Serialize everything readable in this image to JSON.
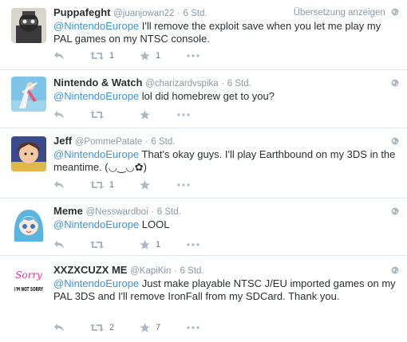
{
  "colors": {
    "link": "#3b94d9",
    "meta": "#8899a6",
    "icon": "#aab8c2",
    "divider": "#e1e8ed"
  },
  "tweets": [
    {
      "name": "Puppafeght",
      "handle": "@juanjowan22",
      "sep": "·",
      "time": "6 Std.",
      "translate_label": "Übersetzung anzeigen",
      "mention": "@NintendoEurope",
      "text": " I'll remove the exploit save when you let me play my PAL games on my NTSC console.",
      "retweets": "1",
      "favorites": "1"
    },
    {
      "name": "Nintendo & Watch",
      "handle": "@charizardvspika",
      "sep": "·",
      "time": "6 Std.",
      "mention": "@NintendoEurope",
      "text": " lol did homebrew get to you?",
      "retweets": "",
      "favorites": ""
    },
    {
      "name": "Jeff",
      "handle": "@PommePatate",
      "sep": "·",
      "time": "6 Std.",
      "mention": "@NintendoEurope",
      "text": " That's okay guys. I'll play Earthbound on my 3DS in the meantime. (◡‿◡✿)",
      "retweets": "1",
      "favorites": ""
    },
    {
      "name": "Meme",
      "handle": "@Nesswardboi",
      "sep": "·",
      "time": "6 Std.",
      "mention": "@NintendoEurope",
      "text": " LOOL",
      "retweets": "",
      "favorites": "1"
    },
    {
      "name": "XXZXCUZX ME",
      "handle": "@KapiKin",
      "sep": "·",
      "time": "6 Std.",
      "mention": "@NintendoEurope",
      "text": " Just make playable NTSC J/EU imported games on my PAL 3DS and I'll remove IronFall from my SDCard. Thank you.",
      "retweets": "2",
      "favorites": "7",
      "avatar_text_top": "Sorry",
      "avatar_text_bottom": "I'M NOT SORRY"
    }
  ]
}
